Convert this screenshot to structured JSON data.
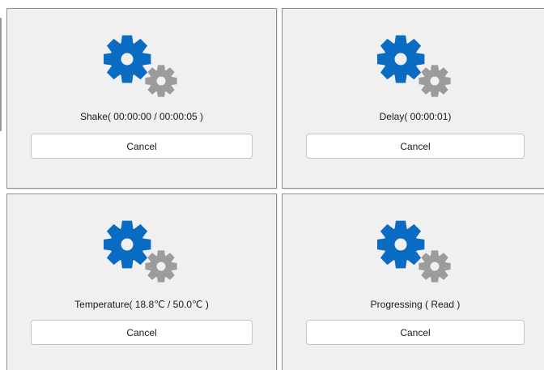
{
  "colors": {
    "gear_primary": "#0a6bc2",
    "gear_secondary": "#9c9c9c",
    "panel_background": "#f0f0f0"
  },
  "panels": [
    {
      "status": "Shake( 00:00:00 / 00:00:05 )",
      "icon": "gears-icon",
      "cancel_label": "Cancel"
    },
    {
      "status": "Delay( 00:00:01)",
      "icon": "gears-icon",
      "cancel_label": "Cancel"
    },
    {
      "status": "Temperature( 18.8℃ / 50.0℃ )",
      "icon": "gears-icon",
      "cancel_label": "Cancel"
    },
    {
      "status": "Progressing ( Read )",
      "icon": "gears-icon",
      "cancel_label": "Cancel"
    }
  ]
}
